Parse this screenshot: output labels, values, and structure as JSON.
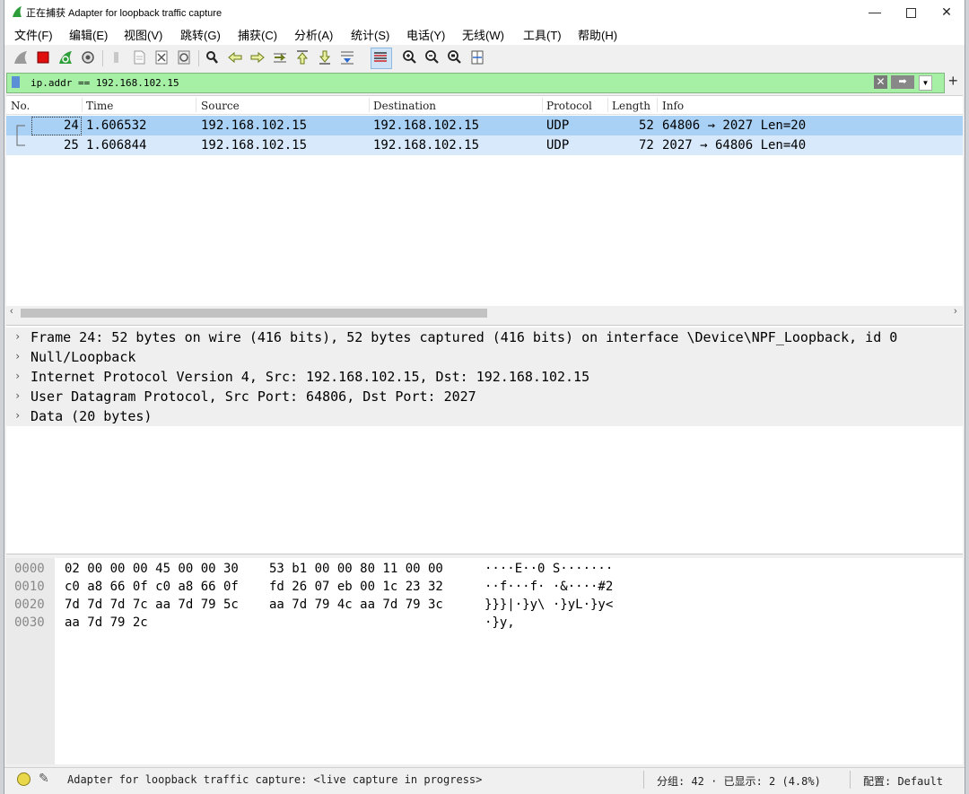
{
  "window": {
    "title": "正在捕获 Adapter for loopback traffic capture",
    "min_glyph": "—",
    "close_glyph": "✕"
  },
  "menu": [
    "文件(F)",
    "编辑(E)",
    "视图(V)",
    "跳转(G)",
    "捕获(C)",
    "分析(A)",
    "统计(S)",
    "电话(Y)",
    "无线(W)",
    "工具(T)",
    "帮助(H)"
  ],
  "toolbar_icons": [
    "shark-fin-start-icon",
    "stop-capture-icon",
    "restart-capture-icon",
    "capture-options-icon",
    "open-file-icon",
    "save-file-icon",
    "close-file-icon",
    "reload-file-icon",
    "find-packet-icon",
    "go-back-icon",
    "go-forward-icon",
    "go-to-packet-icon",
    "go-first-icon",
    "go-last-icon",
    "autoscroll-icon",
    "colorize-icon",
    "zoom-in-icon",
    "zoom-out-icon",
    "zoom-normal-icon",
    "resize-columns-icon"
  ],
  "filter": {
    "value": "ip.addr == 192.168.102.15",
    "clear_glyph": "✕",
    "apply_glyph": "➡",
    "dropdown_glyph": "▼",
    "add_glyph": "+"
  },
  "packet_list": {
    "columns": [
      "No.",
      "Time",
      "Source",
      "Destination",
      "Protocol",
      "Length",
      "Info"
    ],
    "rows": [
      {
        "no": "24",
        "time": "1.606532",
        "source": "192.168.102.15",
        "destination": "192.168.102.15",
        "protocol": "UDP",
        "length": "52",
        "info": "64806 → 2027 Len=20"
      },
      {
        "no": "25",
        "time": "1.606844",
        "source": "192.168.102.15",
        "destination": "192.168.102.15",
        "protocol": "UDP",
        "length": "72",
        "info": "2027 → 64806 Len=40"
      }
    ]
  },
  "details": [
    "Frame 24: 52 bytes on wire (416 bits), 52 bytes captured (416 bits) on interface \\Device\\NPF_Loopback, id 0",
    "Null/Loopback",
    "Internet Protocol Version 4, Src: 192.168.102.15, Dst: 192.168.102.15",
    "User Datagram Protocol, Src Port: 64806, Dst Port: 2027",
    "Data (20 bytes)"
  ],
  "bytes": [
    {
      "offset": "0000",
      "hex1": "02 00 00 00 45 00 00 30",
      "hex2": "53 b1 00 00 80 11 00 00",
      "ascii": "····E··0 S·······"
    },
    {
      "offset": "0010",
      "hex1": "c0 a8 66 0f c0 a8 66 0f",
      "hex2": "fd 26 07 eb 00 1c 23 32",
      "ascii": "··f···f· ·&····#2"
    },
    {
      "offset": "0020",
      "hex1": "7d 7d 7d 7c aa 7d 79 5c",
      "hex2": "aa 7d 79 4c aa 7d 79 3c",
      "ascii": "}}}|·}y\\ ·}yL·}y<"
    },
    {
      "offset": "0030",
      "hex1": "aa 7d 79 2c",
      "hex2": "",
      "ascii": "·}y,"
    }
  ],
  "status": {
    "capture_text": "Adapter for loopback traffic capture: <live capture in progress>",
    "packets_text": "分组: 42 · 已显示: 2 (4.8%)",
    "profile_text": "配置: Default"
  }
}
